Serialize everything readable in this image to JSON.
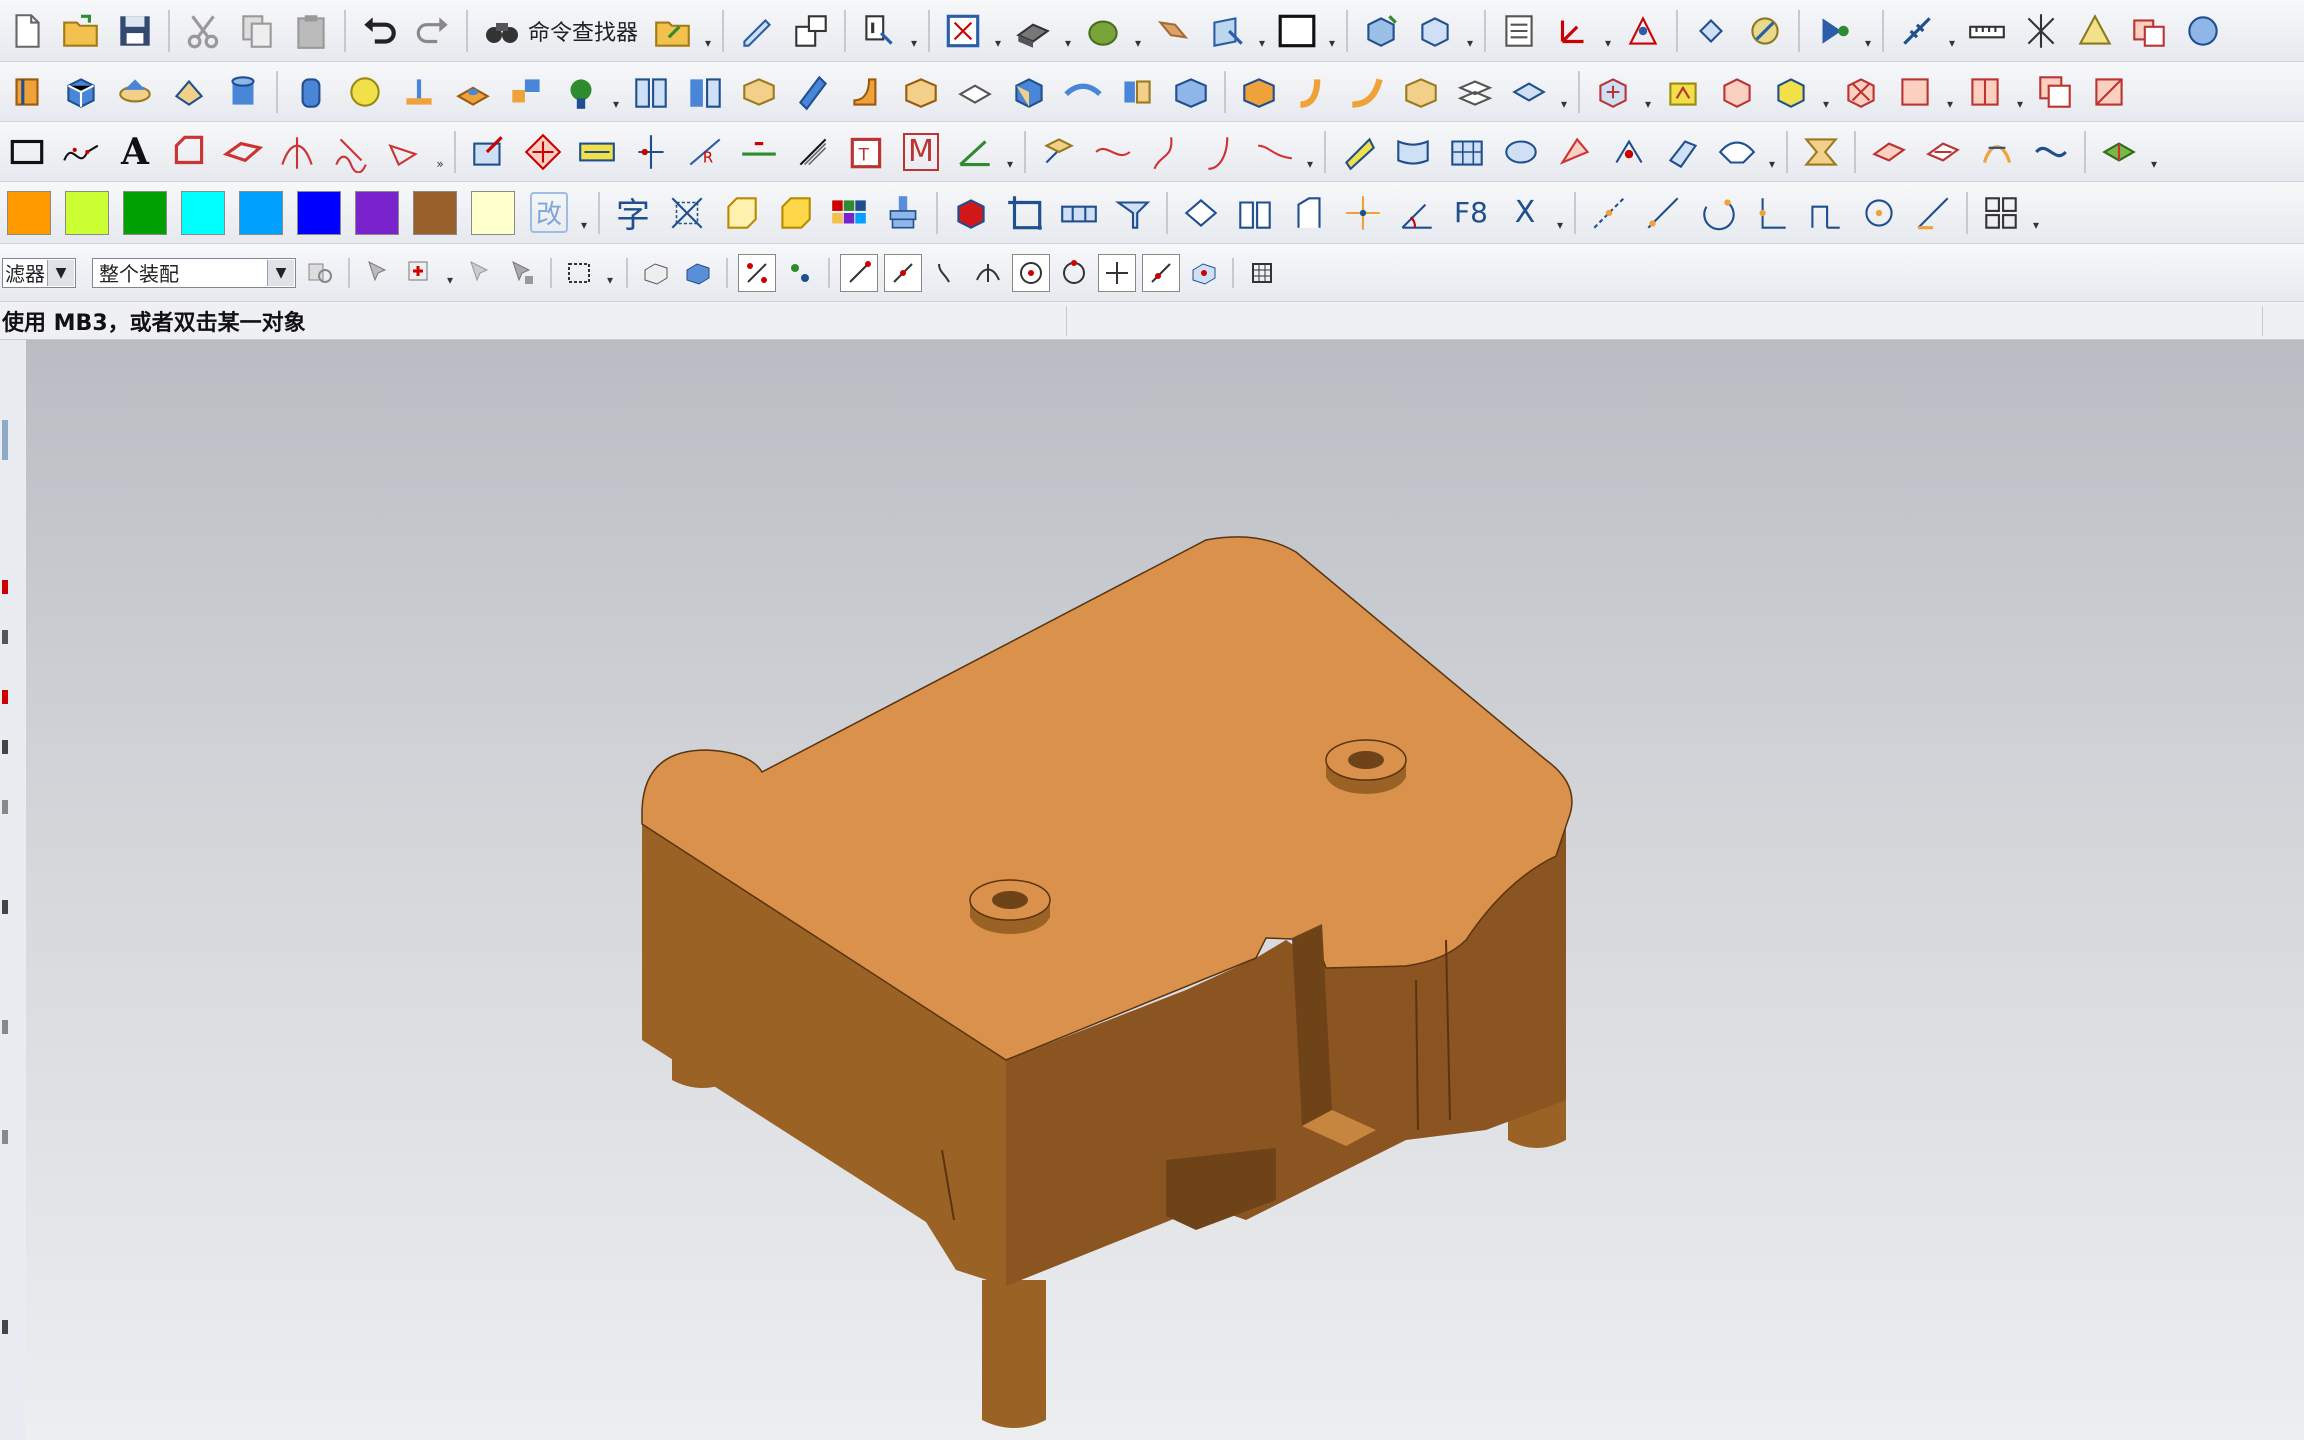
{
  "toolbar": {
    "command_finder_label": "命令查找器"
  },
  "palette": {
    "colors": [
      "#ff9900",
      "#ccff33",
      "#00a000",
      "#00ffff",
      "#00a0ff",
      "#0000ff",
      "#7a22cc",
      "#99602c",
      "#ffffcc"
    ],
    "edit_glyph": "改"
  },
  "annotation": {
    "text_icon_glyph": "A",
    "char_icon_glyph": "字",
    "m_icon_glyph": "M",
    "f8_glyph": "F8",
    "x_icon_glyph": "X"
  },
  "selection_bar": {
    "filter_value": "滤器",
    "scope_value": "整个装配"
  },
  "status": {
    "prompt": "使用 MB3，或者双击某一对象"
  },
  "model": {
    "top_color": "#d9914b",
    "side_color": "#9a6224",
    "dark_color": "#6f4318"
  }
}
